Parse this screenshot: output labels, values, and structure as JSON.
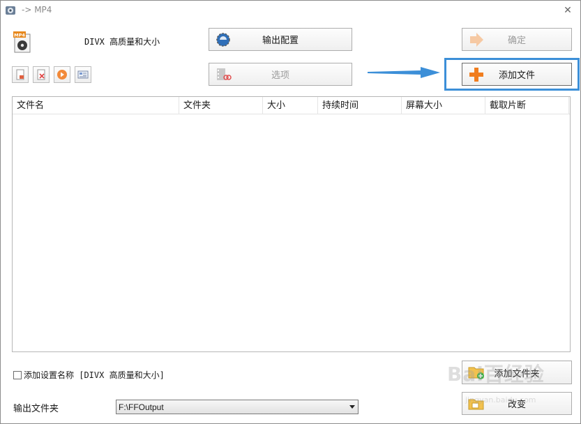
{
  "window": {
    "title": "-> MP4",
    "close_symbol": "✕"
  },
  "profile": {
    "name": "DIVX 高质量和大小",
    "badge": "MP4"
  },
  "buttons": {
    "output_config": "输出配置",
    "options": "选项",
    "ok": "确定",
    "add_file": "添加文件",
    "add_folder": "添加文件夹",
    "change": "改变"
  },
  "file_list": {
    "columns": [
      "文件名",
      "文件夹",
      "大小",
      "持续时间",
      "屏幕大小",
      "截取片断"
    ]
  },
  "checkbox": {
    "label": "添加设置名称 [DIVX 高质量和大小]",
    "checked": false
  },
  "output_folder": {
    "label": "输出文件夹",
    "value": "F:\\FFOutput"
  },
  "watermark": {
    "brand": "Bai百经验",
    "url": "jingyan.baidu.com"
  },
  "colors": {
    "highlight": "#3c8fd8",
    "accent_orange": "#f07d1f"
  }
}
